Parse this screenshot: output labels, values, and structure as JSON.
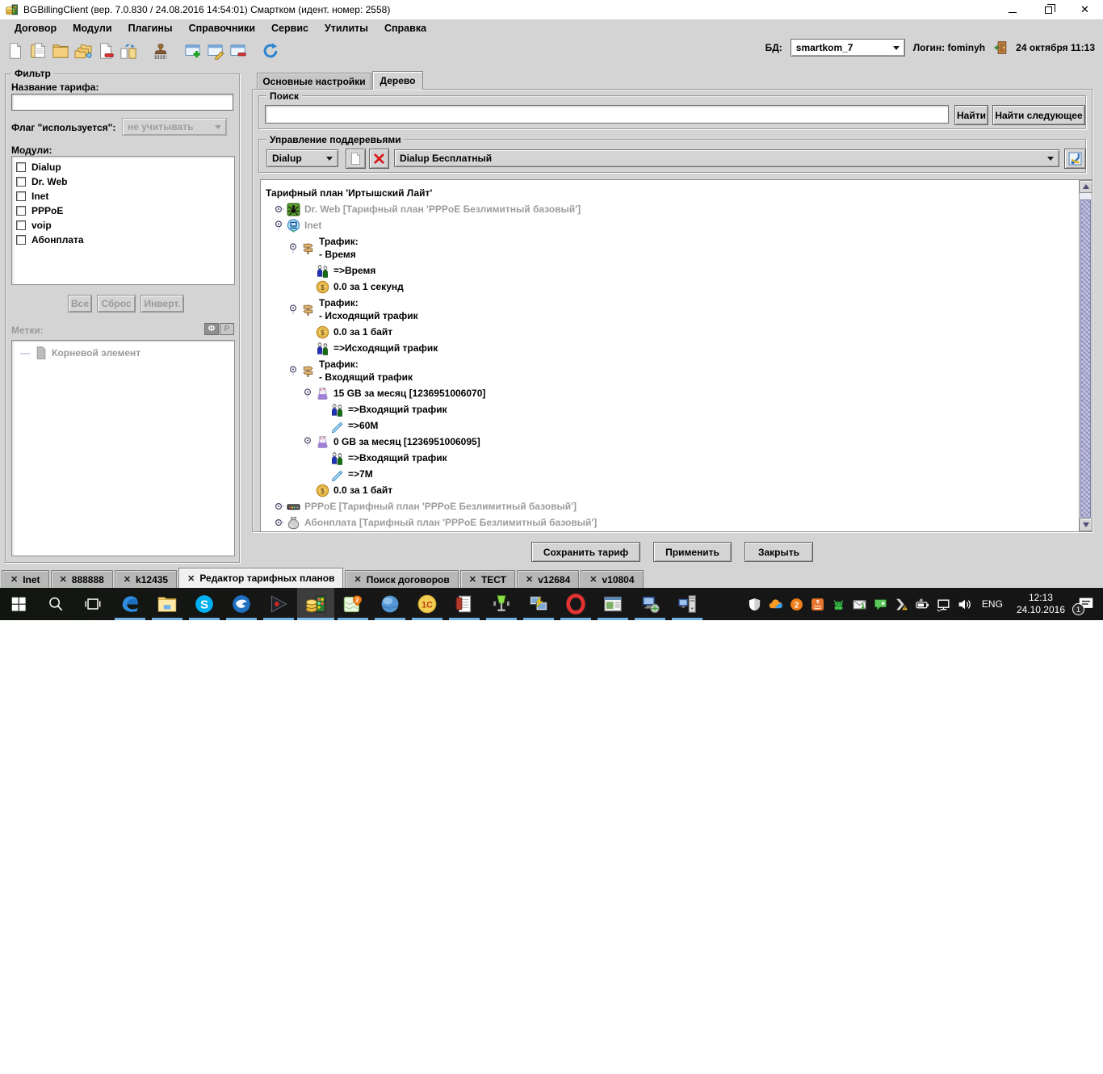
{
  "window": {
    "title": "BGBillingClient (вер. 7.0.830 / 24.08.2016 14:54:01) Смартком (идент. номер: 2558)",
    "controls": [
      "minimize",
      "restore",
      "close"
    ]
  },
  "menubar": {
    "items": [
      "Договор",
      "Модули",
      "Плагины",
      "Справочники",
      "Сервис",
      "Утилиты",
      "Справка"
    ]
  },
  "toolbar": {
    "icons": [
      "new-document",
      "open-document",
      "open-folder",
      "folders",
      "delete-document",
      "transfer-documents",
      "stamp",
      "window-add",
      "window-edit",
      "window-remove",
      "refresh"
    ],
    "db_label": "БД:",
    "db_value": "smartkom_7",
    "login": "Логин: fominyh",
    "exit_icon": "exit-door",
    "datetime": "24 октября 11:13"
  },
  "filter": {
    "title": "Фильтр",
    "name_label": "Название тарифа:",
    "name_value": "",
    "flag_label": "Флаг \"используется\":",
    "flag_value": "не учитывать",
    "modules_label": "Модули:",
    "modules": [
      "Dialup",
      "Dr. Web",
      "Inet",
      "PPPoE",
      "voip",
      "Абонплата"
    ],
    "btn_all": "Все",
    "btn_reset": "Сброс",
    "btn_invert": "Инверт.",
    "labels_title": "Метки:",
    "btn_f": "Ф",
    "btn_r": "Р",
    "labels_root": "Корневой элемент"
  },
  "main": {
    "tab_settings": "Основные настройки",
    "tab_tree": "Дерево",
    "search_title": "Поиск",
    "search_value": "",
    "btn_find": "Найти",
    "btn_find_next": "Найти следующее",
    "subtree_title": "Управление поддеревьями",
    "module_combo": "Dialup",
    "tariff_combo": "Dialup Бесплатный",
    "subtree_icons": [
      "new-document",
      "delete-red-x",
      "move-subtree"
    ],
    "btn_save": "Сохранить тариф",
    "btn_apply": "Применить",
    "btn_close": "Закрыть"
  },
  "tree": {
    "rows": [
      {
        "text": "Тарифный план 'Иртышский Лайт'",
        "icon": null,
        "level": 0
      },
      {
        "text": "Dr. Web [Тарифный план 'PPPoE Безлимитный базовый']",
        "icon": "drweb",
        "level": 1,
        "handle": "collapsed",
        "gray": true
      },
      {
        "text": "Inet",
        "icon": "inet",
        "level": 1,
        "handle": "expanded",
        "gray": true
      },
      {
        "text": "Трафик:",
        "text2": "- Время",
        "icon": "signpost",
        "level": 2,
        "handle": "expanded"
      },
      {
        "text": "=>Время",
        "icon": "people",
        "level": 3
      },
      {
        "text": "0.0 за 1 секунд",
        "icon": "coin",
        "level": 3
      },
      {
        "text": "Трафик:",
        "text2": "- Исходящий трафик",
        "icon": "signpost",
        "level": 2,
        "handle": "expanded"
      },
      {
        "text": "0.0 за 1 байт",
        "icon": "coin",
        "level": 3
      },
      {
        "text": "=>Исходящий трафик",
        "icon": "people",
        "level": 3
      },
      {
        "text": "Трафик:",
        "text2": "- Входящий трафик",
        "icon": "signpost",
        "level": 2,
        "handle": "expanded"
      },
      {
        "text": "15 GB за месяц [1236951006070]",
        "icon": "beaker",
        "level": 3,
        "handle": "expanded"
      },
      {
        "text": "=>Входящий трафик",
        "icon": "people",
        "level": 4
      },
      {
        "text": "=>60M",
        "icon": "pencil-tag",
        "level": 4
      },
      {
        "text": "0 GB за месяц [1236951006095]",
        "icon": "beaker",
        "level": 3,
        "handle": "expanded"
      },
      {
        "text": "=>Входящий трафик",
        "icon": "people",
        "level": 4
      },
      {
        "text": "=>7M",
        "icon": "pencil-tag",
        "level": 4
      },
      {
        "text": "0.0 за 1 байт",
        "icon": "coin",
        "level": 3
      },
      {
        "text": "PPPoE [Тарифный план 'PPPoE Безлимитный базовый']",
        "icon": "modem",
        "level": 1,
        "handle": "collapsed",
        "gray": true
      },
      {
        "text": "Абонплата [Тарифный план 'PPPoE Безлимитный базовый']",
        "icon": "moneybag",
        "level": 1,
        "handle": "collapsed",
        "gray": true
      }
    ]
  },
  "bottom_tabs": [
    "Inet",
    "888888",
    "k12435",
    "Редактор тарифных планов",
    "Поиск договоров",
    "ТЕСТ",
    "v12684",
    "v10804"
  ],
  "taskbar": {
    "left_icons": [
      "start",
      "search",
      "task-view"
    ],
    "apps": [
      "edge",
      "file-explorer",
      "skype",
      "thunderbird",
      "media-player",
      "bgbilling",
      "2gis",
      "sphere-browser",
      "1c",
      "document-editor",
      "nod32",
      "remote-desktop",
      "opera",
      "app-window",
      "network-computer",
      "computer-tower"
    ],
    "tray_icons": [
      "defender-shield",
      "cloud",
      "2gis-tray",
      "java",
      "robot",
      "mail",
      "chat",
      "warning",
      "battery",
      "network",
      "volume"
    ],
    "language": "ENG",
    "time": "12:13",
    "date": "24.10.2016",
    "badge": "1"
  }
}
